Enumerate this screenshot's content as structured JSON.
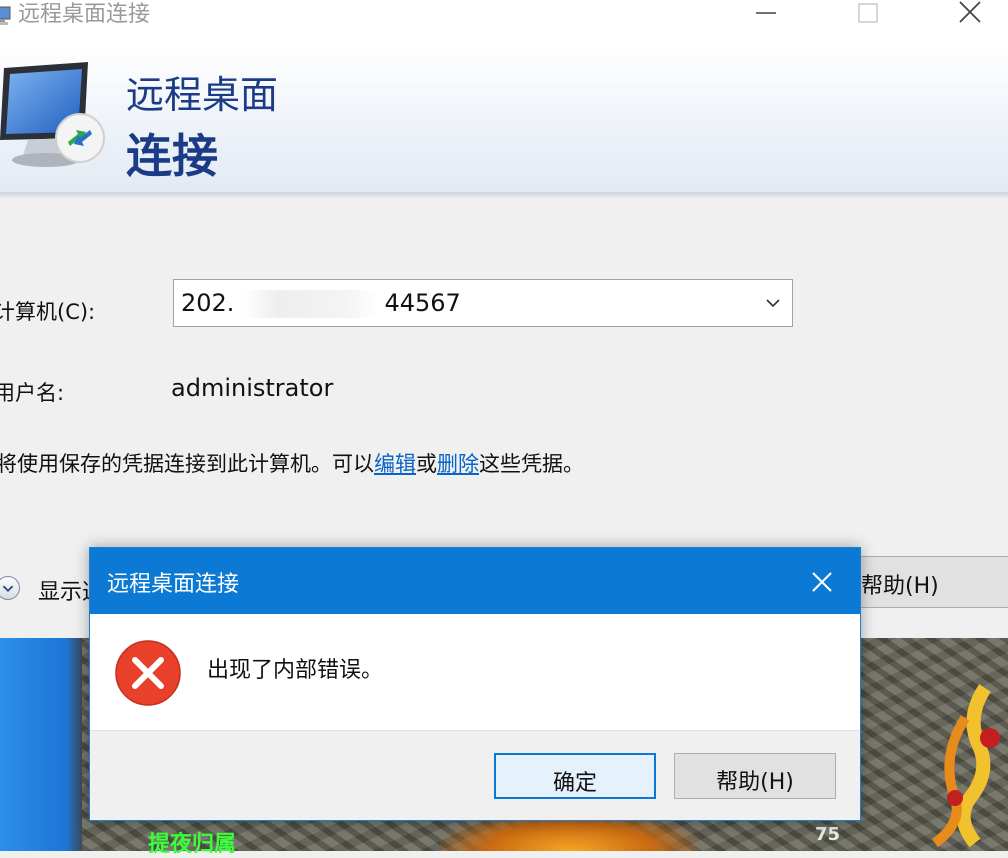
{
  "window": {
    "title": "远程桌面连接",
    "banner_line1": "远程桌面",
    "banner_line2": "连接"
  },
  "form": {
    "computer_label": "计算机(C):",
    "computer_value": "202.",
    "computer_value_tail": "44567",
    "username_label": "用户名:",
    "username_value": "administrator",
    "credentials_text_pre": "将使用保存的凭据连接到此计算机。可以",
    "credentials_edit_link": "编辑",
    "credentials_or": "或",
    "credentials_delete_link": "删除",
    "credentials_text_post": "这些凭据。",
    "options_label": "显示选项(O)",
    "help_button": "帮助(H)"
  },
  "background_game": {
    "green_text": "提夜归属",
    "number": "75"
  },
  "dialog": {
    "title": "远程桌面连接",
    "message": "出现了内部错误。",
    "ok_button": "确定",
    "help_button": "帮助(H)",
    "accent_color": "#0c7ad4",
    "error_color": "#e8402a"
  }
}
